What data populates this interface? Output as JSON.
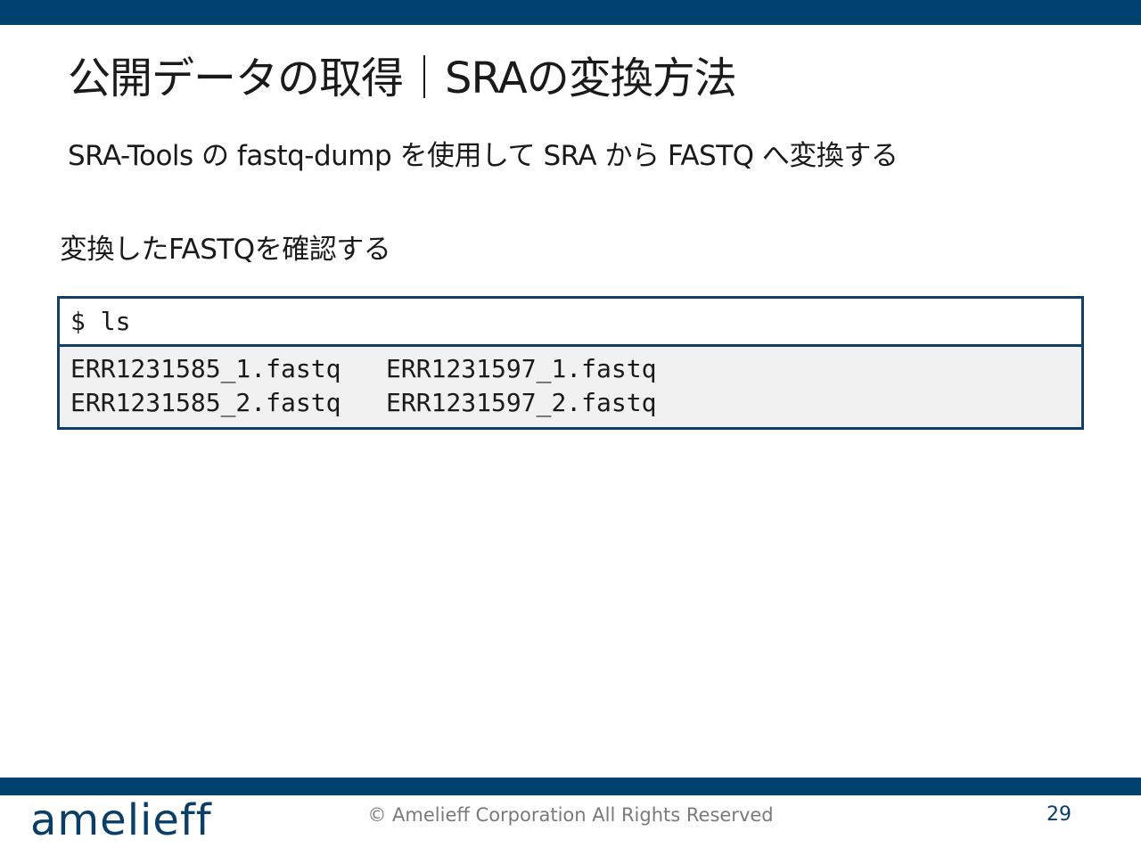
{
  "slide": {
    "title": "公開データの取得｜SRAの変換方法",
    "subtitle": "SRA-Tools の fastq-dump を使用して SRA から FASTQ へ変換する",
    "section_label": "変換したFASTQを確認する"
  },
  "terminal": {
    "command": "$ ls",
    "output": [
      "ERR1231585_1.fastq   ERR1231597_1.fastq",
      "ERR1231585_2.fastq   ERR1231597_2.fastq"
    ]
  },
  "footer": {
    "logo_text": "amelieff",
    "copyright": "© Amelieff Corporation All Rights Reserved",
    "page_number": "29"
  },
  "colors": {
    "brand_navy": "#00426f",
    "terminal_border": "#0f3f64",
    "output_background": "#f1f1f1"
  }
}
